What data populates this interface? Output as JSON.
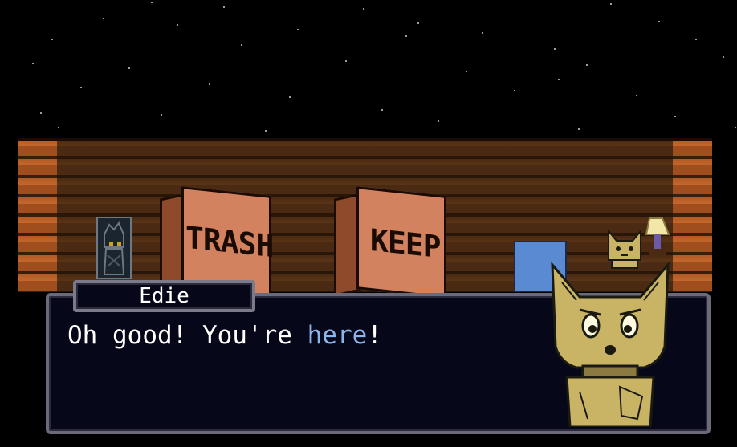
{
  "scene": {
    "boxes": [
      {
        "label": "TRASH"
      },
      {
        "label": "KEEP"
      }
    ]
  },
  "dialogue": {
    "speaker": "Edie",
    "text_before": "Oh good! You're ",
    "text_highlight": "here",
    "text_after": "!"
  },
  "colors": {
    "highlight": "#8ab6ee",
    "box": "#d2825e",
    "wood": "#5a3416",
    "portrait": "#c8b464"
  }
}
